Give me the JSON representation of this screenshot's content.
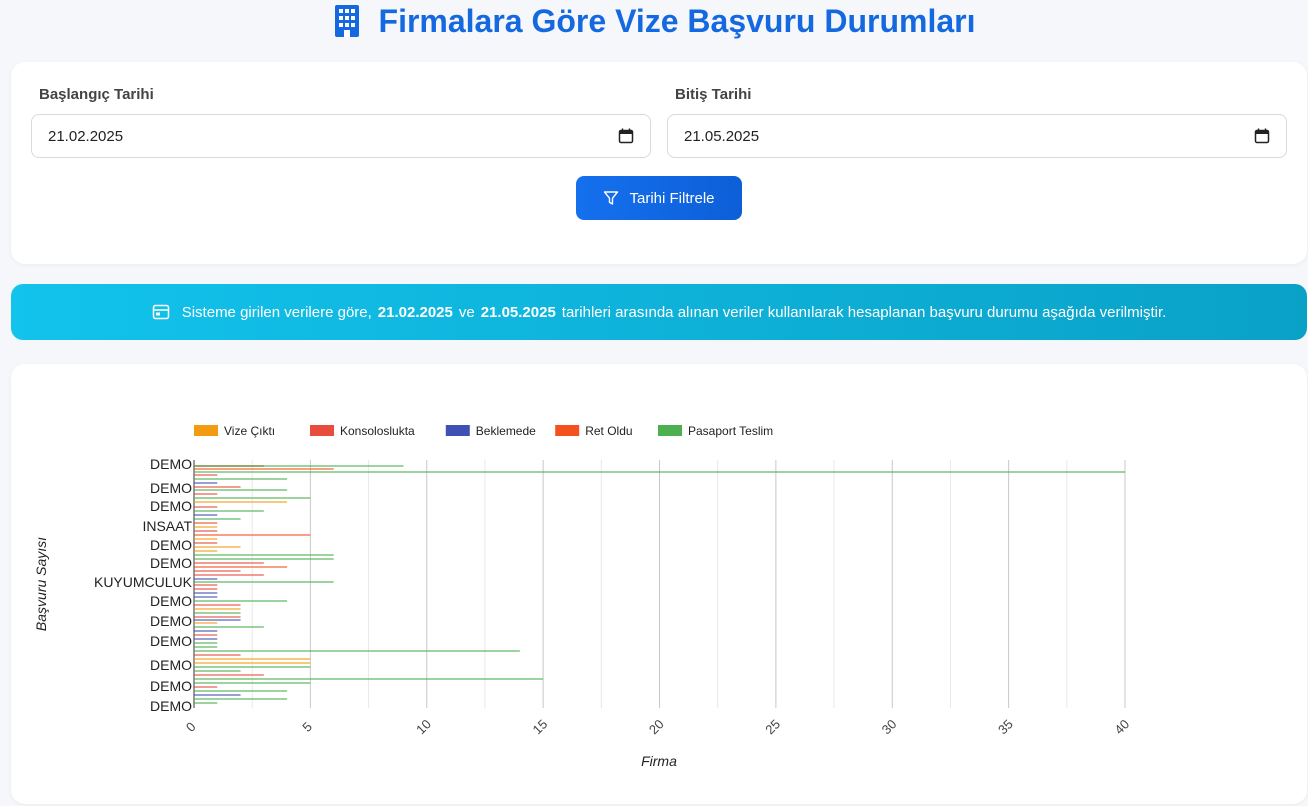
{
  "header": {
    "title": "Firmalara Göre Vize Başvuru Durumları",
    "icon": "building-icon",
    "color": "#1569e0"
  },
  "filter": {
    "start_label": "Başlangıç Tarihi",
    "start_value": "21.02.2025",
    "end_label": "Bitiş Tarihi",
    "end_value": "21.05.2025",
    "button_label": "Tarihi Filtrele",
    "button_icon": "funnel-icon",
    "input_icon": "calendar-icon"
  },
  "banner": {
    "icon": "calendar-card-icon",
    "prefix": "Sisteme girilen verilere göre,",
    "start": "21.02.2025",
    "middle": "ve",
    "end": "21.05.2025",
    "suffix": "tarihleri arasında alınan veriler kullanılarak hesaplanan başvuru durumu aşağıda verilmiştir."
  },
  "chart_data": {
    "type": "bar",
    "orientation": "horizontal",
    "xlabel": "Firma",
    "ylabel": "Başvuru Sayısı",
    "xlim": [
      0,
      40
    ],
    "xticks": [
      0,
      5,
      10,
      15,
      20,
      25,
      30,
      35,
      40
    ],
    "grid": true,
    "legend_position": "top-left",
    "series": [
      {
        "name": "Vize Çıktı",
        "color": "#f39c12"
      },
      {
        "name": "Konsoloslukta",
        "color": "#e74c3c"
      },
      {
        "name": "Beklemede",
        "color": "#3f51b5"
      },
      {
        "name": "Ret Oldu",
        "color": "#f4511e"
      },
      {
        "name": "Pasaport Teslim",
        "color": "#4caf50"
      }
    ],
    "categories": [
      "DEMO",
      "DEMO",
      "DEMO",
      "INSAAT",
      "DEMO",
      "DEMO",
      "KUYUMCULUK",
      "DEMO",
      "DEMO",
      "DEMO",
      "DEMO",
      "DEMO",
      "DEMO"
    ],
    "bars": [
      {
        "y": 466,
        "series": 1,
        "value": 3
      },
      {
        "y": 466,
        "series": 4,
        "value": 9
      },
      {
        "y": 469,
        "series": 3,
        "value": 6
      },
      {
        "y": 472,
        "series": 4,
        "value": 40
      },
      {
        "y": 475,
        "series": 1,
        "value": 1
      },
      {
        "y": 479,
        "series": 4,
        "value": 4
      },
      {
        "y": 483,
        "series": 2,
        "value": 1
      },
      {
        "y": 487,
        "series": 1,
        "value": 2
      },
      {
        "y": 490,
        "series": 4,
        "value": 4
      },
      {
        "y": 494,
        "series": 1,
        "value": 1
      },
      {
        "y": 498,
        "series": 4,
        "value": 5
      },
      {
        "y": 502,
        "series": 0,
        "value": 4
      },
      {
        "y": 507,
        "series": 1,
        "value": 1
      },
      {
        "y": 511,
        "series": 4,
        "value": 3
      },
      {
        "y": 515,
        "series": 2,
        "value": 1
      },
      {
        "y": 519,
        "series": 4,
        "value": 2
      },
      {
        "y": 523,
        "series": 1,
        "value": 1
      },
      {
        "y": 527,
        "series": 0,
        "value": 1
      },
      {
        "y": 531,
        "series": 1,
        "value": 1
      },
      {
        "y": 535,
        "series": 3,
        "value": 5
      },
      {
        "y": 539,
        "series": 0,
        "value": 1
      },
      {
        "y": 543,
        "series": 1,
        "value": 1
      },
      {
        "y": 547,
        "series": 0,
        "value": 2
      },
      {
        "y": 551,
        "series": 0,
        "value": 1
      },
      {
        "y": 555,
        "series": 4,
        "value": 6
      },
      {
        "y": 559,
        "series": 4,
        "value": 6
      },
      {
        "y": 563,
        "series": 1,
        "value": 3
      },
      {
        "y": 567,
        "series": 3,
        "value": 4
      },
      {
        "y": 571,
        "series": 1,
        "value": 2
      },
      {
        "y": 575,
        "series": 1,
        "value": 3
      },
      {
        "y": 579,
        "series": 2,
        "value": 1
      },
      {
        "y": 582,
        "series": 4,
        "value": 6
      },
      {
        "y": 585,
        "series": 1,
        "value": 1
      },
      {
        "y": 589,
        "series": 1,
        "value": 1
      },
      {
        "y": 593,
        "series": 2,
        "value": 1
      },
      {
        "y": 597,
        "series": 2,
        "value": 1
      },
      {
        "y": 601,
        "series": 4,
        "value": 4
      },
      {
        "y": 605,
        "series": 1,
        "value": 2
      },
      {
        "y": 609,
        "series": 0,
        "value": 2
      },
      {
        "y": 613,
        "series": 4,
        "value": 2
      },
      {
        "y": 617,
        "series": 1,
        "value": 2
      },
      {
        "y": 620,
        "series": 2,
        "value": 2
      },
      {
        "y": 623,
        "series": 0,
        "value": 1
      },
      {
        "y": 627,
        "series": 4,
        "value": 3
      },
      {
        "y": 631,
        "series": 2,
        "value": 1
      },
      {
        "y": 635,
        "series": 1,
        "value": 1
      },
      {
        "y": 639,
        "series": 2,
        "value": 1
      },
      {
        "y": 643,
        "series": 4,
        "value": 1
      },
      {
        "y": 647,
        "series": 4,
        "value": 1
      },
      {
        "y": 651,
        "series": 4,
        "value": 14
      },
      {
        "y": 655,
        "series": 1,
        "value": 2
      },
      {
        "y": 659,
        "series": 0,
        "value": 5
      },
      {
        "y": 663,
        "series": 0,
        "value": 5
      },
      {
        "y": 667,
        "series": 4,
        "value": 5
      },
      {
        "y": 671,
        "series": 4,
        "value": 2
      },
      {
        "y": 675,
        "series": 1,
        "value": 3
      },
      {
        "y": 679,
        "series": 4,
        "value": 15
      },
      {
        "y": 683,
        "series": 4,
        "value": 5
      },
      {
        "y": 687,
        "series": 1,
        "value": 1
      },
      {
        "y": 691,
        "series": 4,
        "value": 4
      },
      {
        "y": 695,
        "series": 2,
        "value": 2
      },
      {
        "y": 699,
        "series": 4,
        "value": 4
      },
      {
        "y": 703,
        "series": 4,
        "value": 1
      }
    ]
  }
}
